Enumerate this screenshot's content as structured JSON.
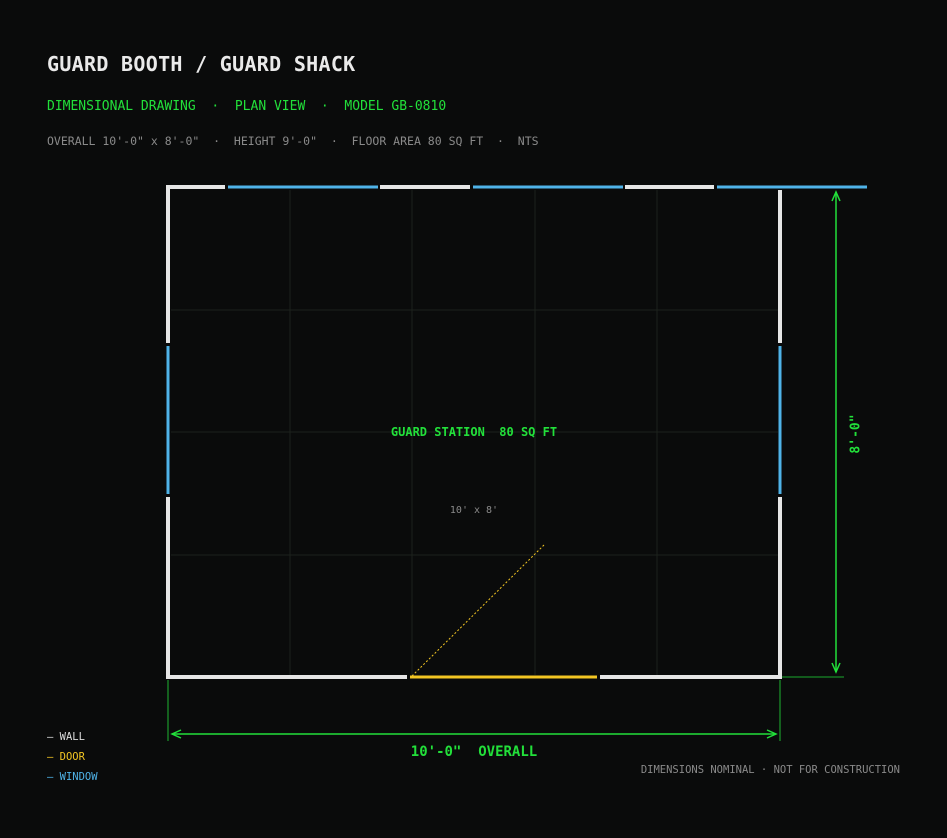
{
  "header": {
    "title": "GUARD BOOTH / GUARD SHACK",
    "subtitle": "DIMENSIONAL DRAWING  ·  PLAN VIEW  ·  MODEL GB-0810",
    "specs": "OVERALL 10'-0\" x 8'-0\"  ·  HEIGHT 9'-0\"  ·  FLOOR AREA 80 SQ FT  ·  NTS"
  },
  "plan": {
    "room_label": "GUARD STATION  80 SQ FT",
    "room_size": "10' x 8'",
    "width_dimension": "10'-0\"  OVERALL",
    "depth_dimension": "8'-0\""
  },
  "legend": {
    "wall": "— WALL",
    "door": "— DOOR",
    "window": "— WINDOW"
  },
  "footer_note": "DIMENSIONS NOMINAL · NOT FOR CONSTRUCTION",
  "colors": {
    "background": "#0a0b0b",
    "wall": "#e6e6e6",
    "window": "#4fb3e8",
    "door": "#f3c623",
    "dimension": "#22e03a",
    "grid": "#1c211d"
  }
}
